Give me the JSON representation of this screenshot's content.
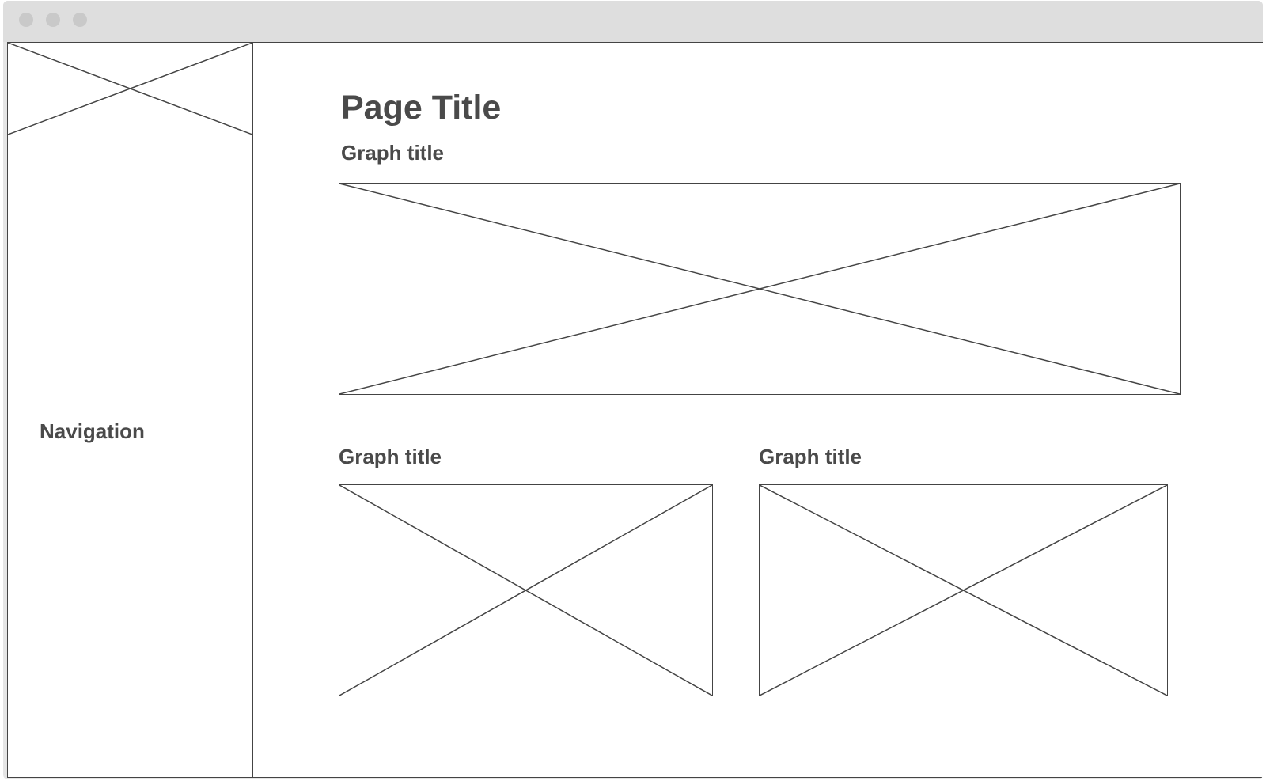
{
  "window": {
    "controls": [
      "close",
      "minimize",
      "maximize"
    ]
  },
  "sidebar": {
    "logo_icon": "image-placeholder-icon",
    "navigation_label": "Navigation"
  },
  "main": {
    "page_title": "Page Title",
    "graphs": [
      {
        "title": "Graph title",
        "placeholder_icon": "image-placeholder-icon"
      },
      {
        "title": "Graph title",
        "placeholder_icon": "image-placeholder-icon"
      },
      {
        "title": "Graph title",
        "placeholder_icon": "image-placeholder-icon"
      }
    ]
  },
  "colors": {
    "line": "#444444",
    "text": "#4a4a4a",
    "titlebar": "#dedede",
    "window_dot": "#c9c9c9",
    "background": "#ffffff"
  }
}
